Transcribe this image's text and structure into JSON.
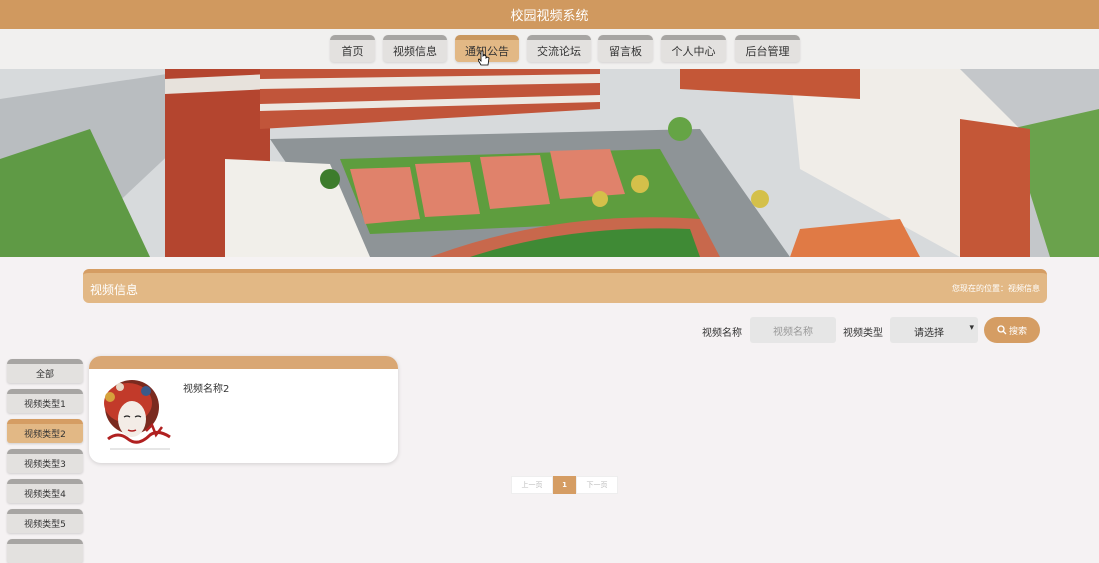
{
  "header": {
    "title": "校园视频系统"
  },
  "nav": {
    "items": [
      {
        "label": "首页"
      },
      {
        "label": "视频信息"
      },
      {
        "label": "通知公告"
      },
      {
        "label": "交流论坛"
      },
      {
        "label": "留言板"
      },
      {
        "label": "个人中心"
      },
      {
        "label": "后台管理"
      }
    ],
    "active_index": 2
  },
  "section": {
    "title": "视频信息",
    "breadcrumb": "您现在的位置：视频信息"
  },
  "search": {
    "name_label": "视频名称",
    "name_placeholder": "视频名称",
    "type_label": "视频类型",
    "type_value": "请选择",
    "button_label": "搜索"
  },
  "categories": {
    "items": [
      "全部",
      "视频类型1",
      "视频类型2",
      "视频类型3",
      "视频类型4",
      "视频类型5"
    ],
    "active_index": 2
  },
  "videos": [
    {
      "name": "视频名称2"
    }
  ],
  "pagination": {
    "prev": "上一页",
    "current": "1",
    "next": "下一页"
  },
  "colors": {
    "accent": "#d59d63",
    "accent_light": "#e2b885",
    "header": "#d0995f"
  }
}
